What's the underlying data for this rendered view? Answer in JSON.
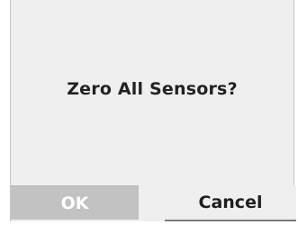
{
  "dialog": {
    "message": "Zero All Sensors?",
    "ok_label": "OK",
    "cancel_label": "Cancel"
  }
}
